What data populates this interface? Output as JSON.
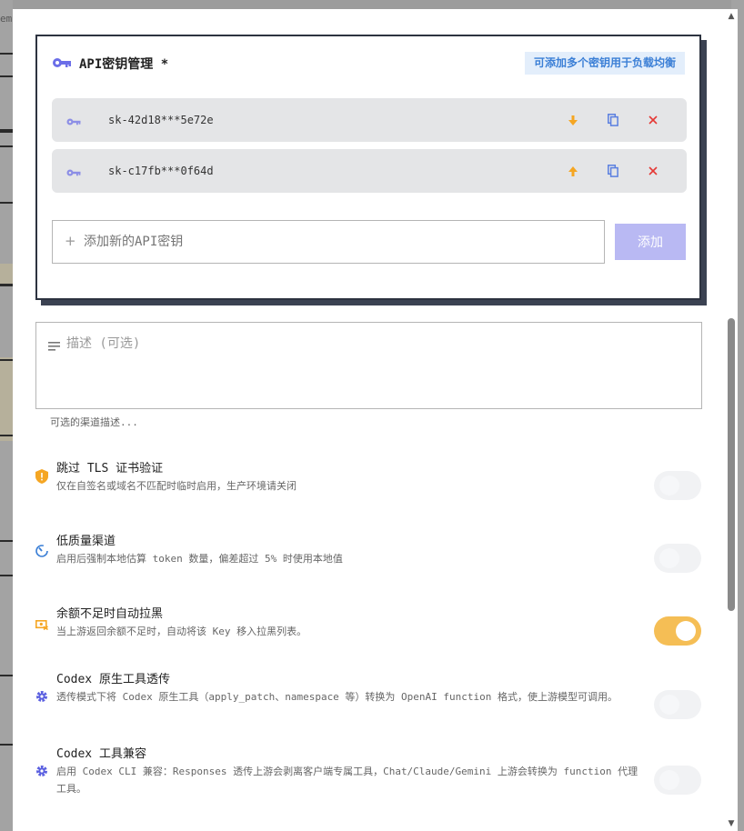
{
  "backdrop": {
    "stub_text": "em"
  },
  "keys": {
    "title": "API密钥管理",
    "required_mark": "*",
    "hint": "可添加多个密钥用于负载均衡",
    "items": [
      {
        "value": "sk-42d18***5e72e",
        "move": "down"
      },
      {
        "value": "sk-c17fb***0f64d",
        "move": "up"
      }
    ],
    "new_key_placeholder": "添加新的API密钥",
    "add_label": "添加"
  },
  "description": {
    "placeholder": "描述 (可选)",
    "help": "可选的渠道描述..."
  },
  "settings": [
    {
      "title": "跳过 TLS 证书验证",
      "desc": "仅在自签名或域名不匹配时临时启用，生产环境请关闭",
      "on": false,
      "icon": "shield-alert-icon"
    },
    {
      "title": "低质量渠道",
      "desc": "启用后强制本地估算 token 数量，偏差超过 5% 时使用本地值",
      "on": false,
      "icon": "gauge-icon"
    },
    {
      "title": "余额不足时自动拉黑",
      "desc": "当上游返回余额不足时，自动将该 Key 移入拉黑列表。",
      "on": true,
      "icon": "money-off-icon"
    },
    {
      "title": "Codex 原生工具透传",
      "desc": "透传模式下将 Codex 原生工具（apply_patch、namespace 等）转换为 OpenAI function 格式，使上游模型可调用。",
      "on": false,
      "icon": "gear-icon"
    },
    {
      "title": "Codex 工具兼容",
      "desc": "启用 Codex CLI 兼容：Responses 透传上游会剥离客户端专属工具，Chat/Claude/Gemini 上游会转换为 function 代理工具。",
      "on": false,
      "icon": "gear-icon"
    }
  ],
  "colors": {
    "accent": "#6b6ee8",
    "warning": "#f5a623",
    "danger": "#e53935",
    "toggle_on": "#f5be55",
    "hint_bg": "#e3eefb",
    "hint_text": "#3b7fd6"
  }
}
